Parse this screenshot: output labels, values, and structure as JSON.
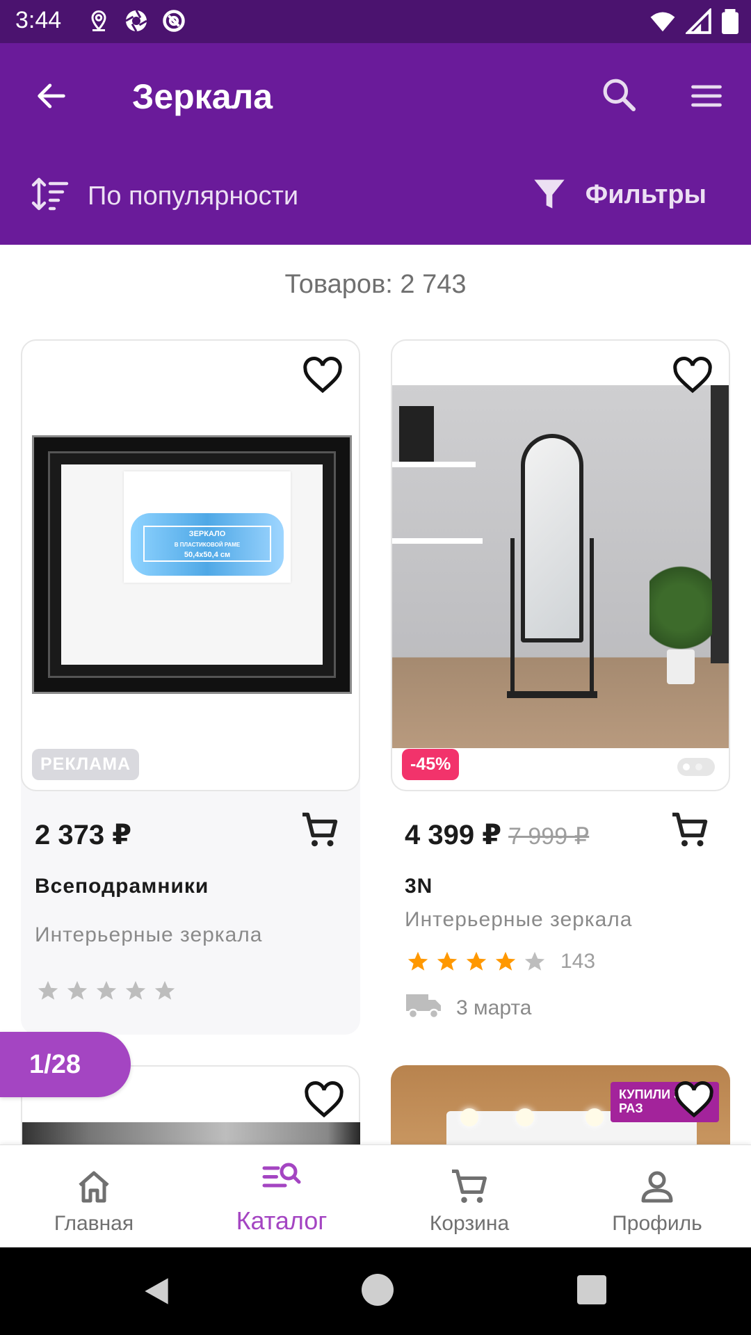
{
  "status_bar": {
    "time": "3:44",
    "left_icons": [
      "location-icon",
      "aperture-icon",
      "at-icon"
    ],
    "right_icons": [
      "wifi-icon",
      "signal-icon",
      "battery-icon"
    ]
  },
  "app_bar": {
    "title": "Зеркала",
    "sort_label": "По популярности",
    "filters_label": "Фильтры",
    "background": "#6a1b9a"
  },
  "product_count": "Товаров: 2 743",
  "products": [
    {
      "price": "2 373 ₽",
      "old_price": "",
      "brand": "Всеподрамники",
      "category": "Интерьерные зеркала",
      "badge": "РЕКЛАМА",
      "rating": 0,
      "reviews": "",
      "delivery": "",
      "image_text": [
        "ЗЕРКАЛО",
        "В ПЛАСТИКОВОЙ РАМЕ",
        "50,4x50,4 см"
      ]
    },
    {
      "price": "4 399 ₽",
      "old_price": "7 999 ₽",
      "brand": "3N",
      "category": "Интерьерные зеркала",
      "badge": "-45%",
      "rating": 4,
      "reviews": "143",
      "delivery": "3 марта"
    },
    {
      "badge_image_text": "КУПИЛИ 3000 РАЗ"
    }
  ],
  "pager": "1/28",
  "bottom_nav": [
    {
      "label": "Главная",
      "icon": "home-icon"
    },
    {
      "label": "Каталог",
      "icon": "catalog-search-icon",
      "active": true
    },
    {
      "label": "Корзина",
      "icon": "cart-icon"
    },
    {
      "label": "Профиль",
      "icon": "profile-icon"
    }
  ],
  "colors": {
    "accent": "#a445c2",
    "discount": "#f2336b",
    "star": "#ff9800"
  }
}
